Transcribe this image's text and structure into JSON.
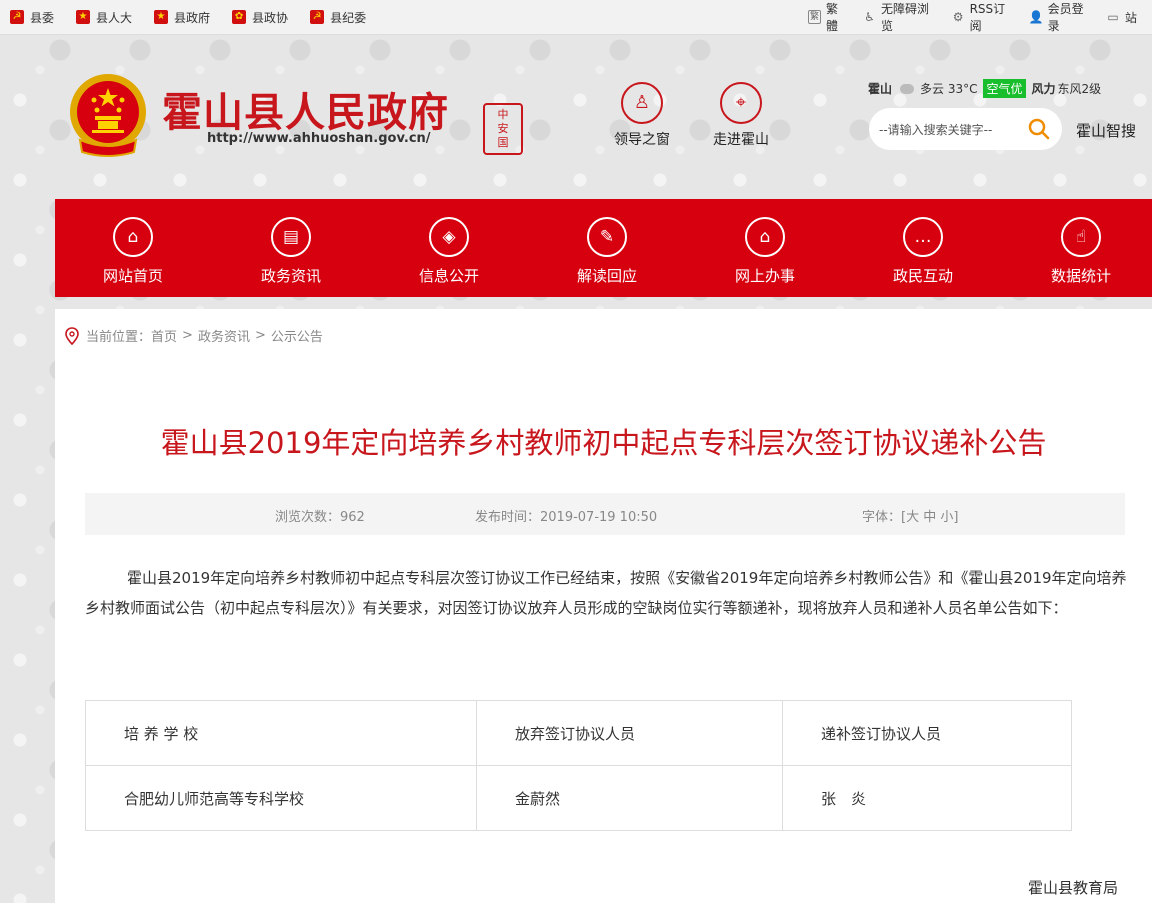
{
  "topbar": {
    "left_links": [
      {
        "label": "县委",
        "icon": "party-flag-icon"
      },
      {
        "label": "县人大",
        "icon": "national-emblem-icon"
      },
      {
        "label": "县政府",
        "icon": "national-emblem-icon"
      },
      {
        "label": "县政协",
        "icon": "cppcc-emblem-icon"
      },
      {
        "label": "县纪委",
        "icon": "party-flag-icon"
      }
    ],
    "right_links": [
      {
        "label": "繁體",
        "icon": "traditional-chinese-icon",
        "glyph": "繁"
      },
      {
        "label": "无障碍浏览",
        "icon": "accessibility-icon",
        "glyph": "♿"
      },
      {
        "label": "RSS订阅",
        "icon": "rss-icon",
        "glyph": "⚙"
      },
      {
        "label": "会员登录",
        "icon": "user-icon",
        "glyph": "👤"
      },
      {
        "label": "站",
        "icon": "window-icon",
        "glyph": "▭"
      }
    ]
  },
  "header": {
    "site_title": "霍山县人民政府",
    "site_url": "http://www.ahhuoshan.gov.cn/",
    "seal_lines": [
      "中",
      "安",
      "国"
    ],
    "quick_links": [
      {
        "label": "领导之窗",
        "icon": "leader-icon",
        "glyph": "♙"
      },
      {
        "label": "走进霍山",
        "icon": "location-icon",
        "glyph": "⌖"
      }
    ],
    "weather": {
      "city": "霍山",
      "condition": "多云 33°C",
      "aqi": "空气优",
      "wind_label": "风力",
      "wind_value": "东风2级"
    },
    "search": {
      "placeholder": "--请输入搜索关键字--",
      "smart_label": "霍山智搜"
    }
  },
  "nav": {
    "items": [
      {
        "label": "网站首页",
        "icon": "home-icon",
        "glyph": "⌂"
      },
      {
        "label": "政务资讯",
        "icon": "newspaper-icon",
        "glyph": "▤"
      },
      {
        "label": "信息公开",
        "icon": "layers-icon",
        "glyph": "◈"
      },
      {
        "label": "解读回应",
        "icon": "document-icon",
        "glyph": "✎"
      },
      {
        "label": "网上办事",
        "icon": "government-building-icon",
        "glyph": "⌂"
      },
      {
        "label": "政民互动",
        "icon": "chat-icon",
        "glyph": "…"
      },
      {
        "label": "数据统计",
        "icon": "hand-pointer-icon",
        "glyph": "☝"
      }
    ]
  },
  "breadcrumb": {
    "prefix": "当前位置：",
    "items": [
      "首页",
      "政务资讯",
      "公示公告"
    ],
    "separator": ">"
  },
  "article": {
    "title": "霍山县2019年定向培养乡村教师初中起点专科层次签订协议递补公告",
    "views_label": "浏览次数：962",
    "publish_label": "发布时间：2019-07-19 10:50",
    "font_size_label": "字体：[大 中 小]",
    "body": "霍山县2019年定向培养乡村教师初中起点专科层次签订协议工作已经结束，按照《安徽省2019年定向培养乡村教师公告》和《霍山县2019年定向培养乡村教师面试公告（初中起点专科层次）》有关要求，对因签订协议放弃人员形成的空缺岗位实行等额递补，现将放弃人员和递补人员名单公告如下：",
    "table": {
      "headers": [
        "培 养 学 校",
        "放弃签订协议人员",
        "递补签订协议人员"
      ],
      "rows": [
        [
          "合肥幼儿师范高等专科学校",
          "金蔚然",
          "张　炎"
        ]
      ]
    },
    "signature": "霍山县教育局"
  },
  "colors": {
    "brand_red": "#d6000f",
    "title_red": "#c8161d",
    "search_accent": "#f08c00",
    "aqi_green": "#19be2c"
  }
}
